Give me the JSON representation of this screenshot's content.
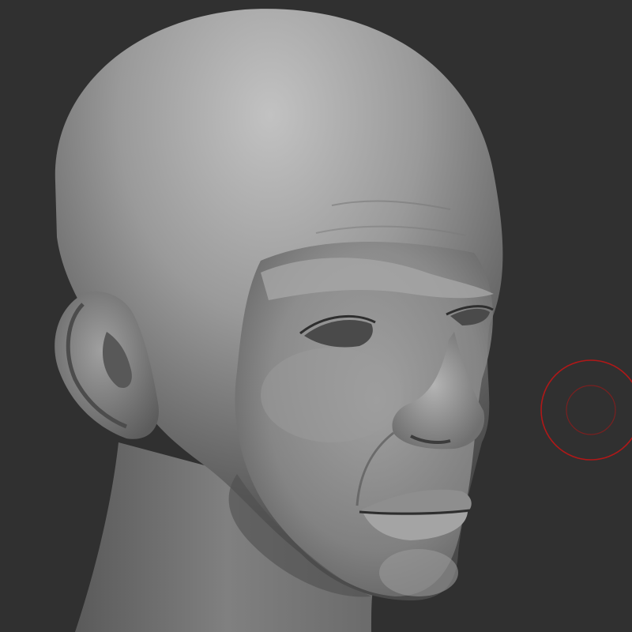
{
  "viewport": {
    "background_color": "#303030",
    "model": {
      "subject": "head-sculpt",
      "material_base": "#8c8c8c",
      "material_highlight": "#bdbdbd",
      "material_shadow": "#3e3e3e"
    },
    "brush_cursor": {
      "icon": "brush-cursor-icon",
      "outer_ring_color": "#b01818",
      "inner_ring_color": "#7a2020"
    }
  }
}
